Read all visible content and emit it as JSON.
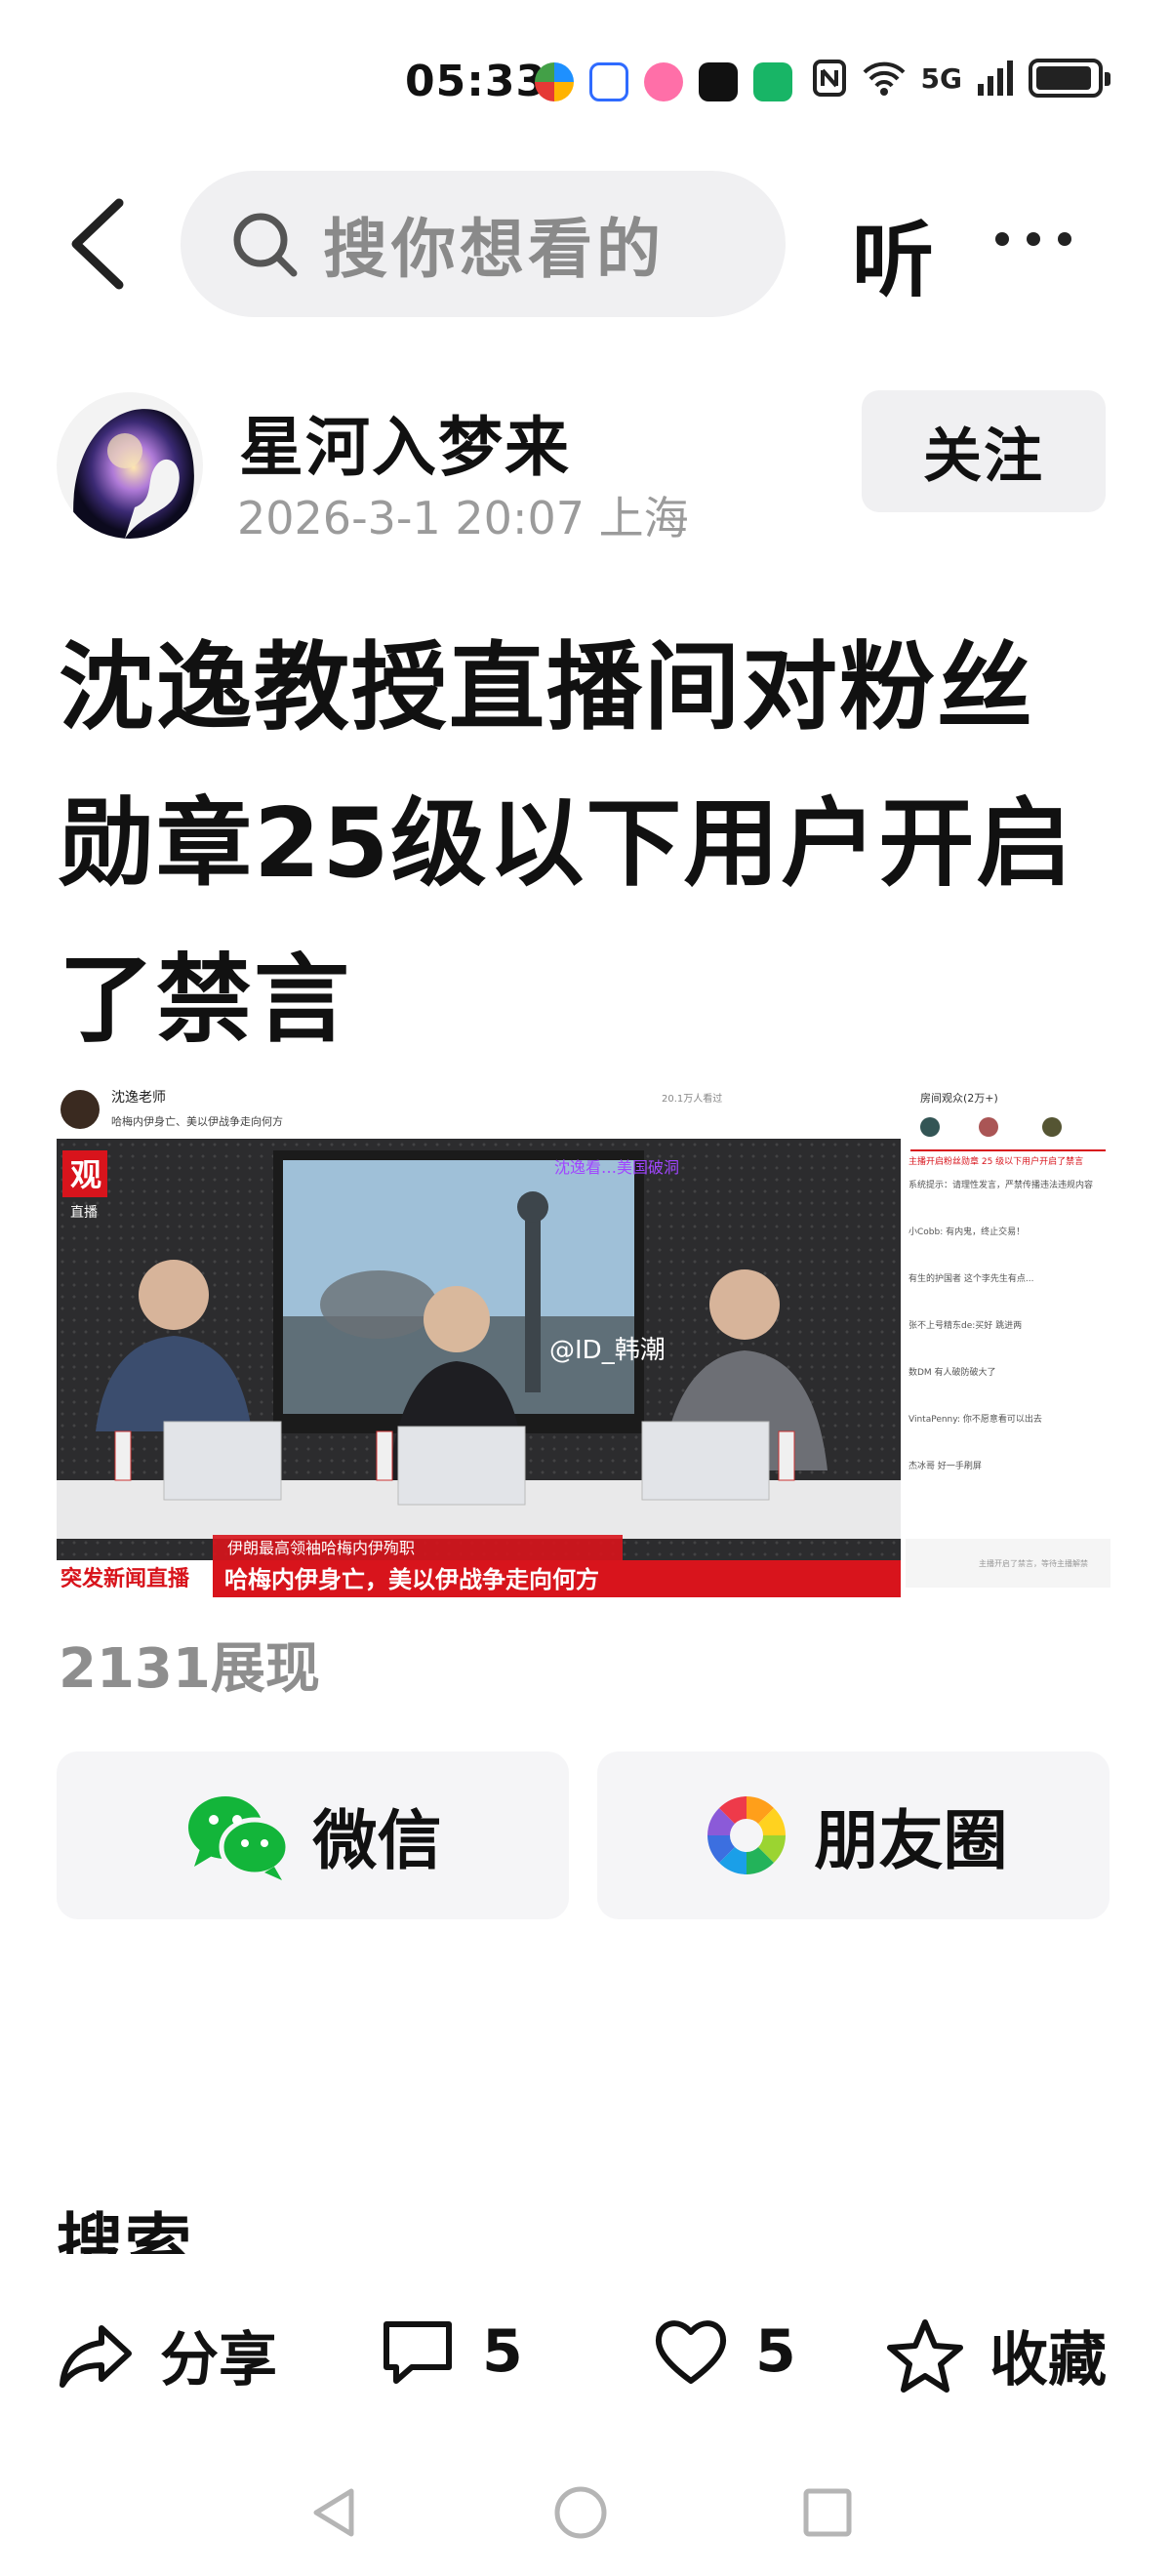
{
  "status_bar": {
    "time": "05:33",
    "network": "5G",
    "icons": [
      "nfc-icon",
      "wifi-icon",
      "signal-icon",
      "battery-icon"
    ],
    "app_icons": [
      "browser-app-icon",
      "baidu-app-icon",
      "app-icon-3",
      "douyin-app-icon",
      "app-icon-5"
    ]
  },
  "top_nav": {
    "search_placeholder": "搜你想看的",
    "listen_label": "听"
  },
  "author": {
    "name": "星河入梦来",
    "meta": "2026-3-1 20:07 上海",
    "follow_label": "关注"
  },
  "article": {
    "title": "沈逸教授直播间对粉丝勋章25级以下用户开启了禁言",
    "views": "2131展现"
  },
  "screenshot_image": {
    "streamer_name": "沈逸老师",
    "stream_subtitle": "哈梅内伊身亡、美以伊战争走向何方",
    "stream_stats": "20.1万人看过",
    "channel_badge": "观",
    "channel_label": "直播",
    "watermark": "@ID_韩潮",
    "banner_top": "伊朗最高领袖哈梅内伊殉职",
    "banner_left": "突发新闻直播",
    "banner_main": "哈梅内伊身亡，美以伊战争走向何方",
    "chat_header": "房间观众(2万+)",
    "chat_notice": "主播开启粉丝勋章 25 级以下用户开启了禁言",
    "chat_lines": [
      "系统提示：请理性发言，严禁传播违法违规内容",
      "小Cobb: 有内鬼，终止交易！",
      "有生的护国者  这个李先生有点...",
      "张不上号精东de:买好  跳进两",
      "数DM  有人破防破大了",
      "VintaPenny: 你不愿意看可以出去",
      "杰冰哥  好一手刷屏"
    ],
    "chat_footer": "主播开启了禁言，等待主播解禁",
    "colors": {
      "banner_red": "#d8141c",
      "chat_bg": "#ffffff",
      "studio_bg": "#2c2c2e"
    }
  },
  "share": {
    "wechat_label": "微信",
    "moments_label": "朋友圈"
  },
  "related": {
    "heading": "搜索"
  },
  "actions": {
    "share_label": "分享",
    "comment_count": "5",
    "like_count": "5",
    "collect_label": "收藏"
  }
}
